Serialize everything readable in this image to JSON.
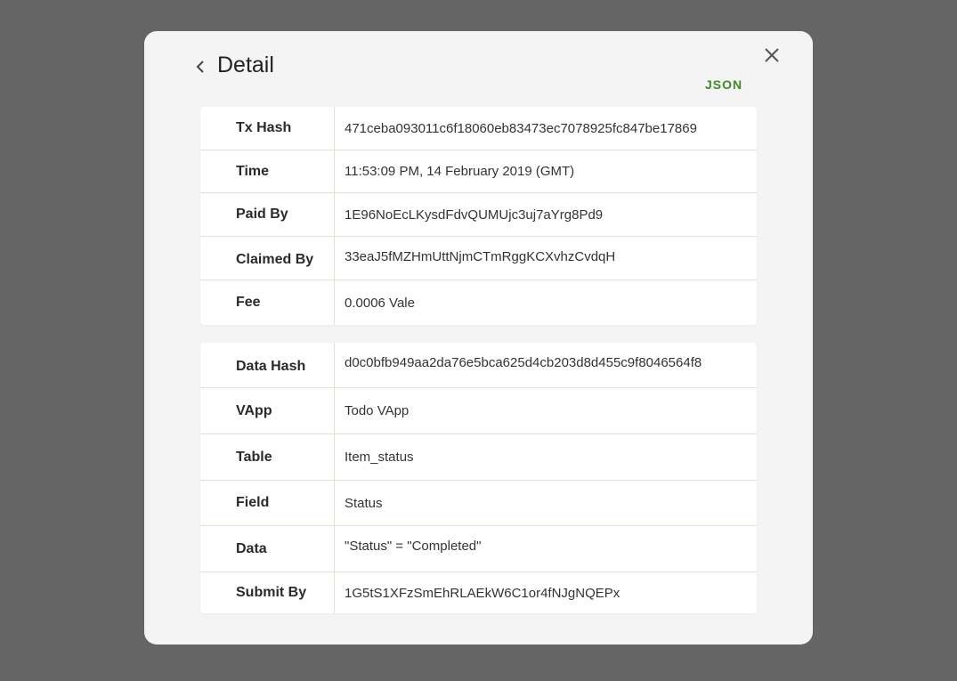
{
  "header": {
    "title": "Detail",
    "json_label": "JSON"
  },
  "icons": {
    "back": "chevron-left-icon",
    "close": "close-icon"
  },
  "colors": {
    "overlay": "#656565",
    "modal_background": "#f4f4f4",
    "card_background": "#ffffff",
    "json_link": "#3e8a27",
    "row_divider": "#e6e0cf"
  },
  "transaction": [
    {
      "label": "Tx Hash",
      "value": "471ceba093011c6f18060eb83473ec7078925fc847be17869"
    },
    {
      "label": "Time",
      "value": "11:53:09 PM, 14 February 2019 (GMT)"
    },
    {
      "label": "Paid By",
      "value": "1E96NoEcLKysdFdvQUMUjc3uj7aYrg8Pd9"
    },
    {
      "label": "Claimed By",
      "value": "33eaJ5fMZHmUttNjmCTmRggKCXvhzCvdqH"
    },
    {
      "label": "Fee",
      "value": "0.0006 Vale"
    }
  ],
  "data_details": [
    {
      "label": "Data Hash",
      "value": "d0c0bfb949aa2da76e5bca625d4cb203d8d455c9f8046564f8"
    },
    {
      "label": "VApp",
      "value": "Todo VApp"
    },
    {
      "label": "Table",
      "value": "Item_status"
    },
    {
      "label": "Field",
      "value": "Status"
    },
    {
      "label": "Data",
      "value": "\"Status\" = \"Completed\""
    },
    {
      "label": "Submit By",
      "value": "1G5tS1XFzSmEhRLAEkW6C1or4fNJgNQEPx"
    }
  ]
}
